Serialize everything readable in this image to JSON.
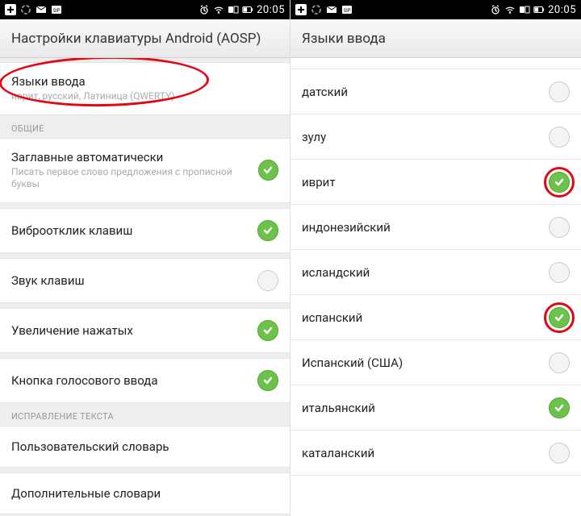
{
  "status": {
    "time": "20:05"
  },
  "left": {
    "title": "Настройки клавиатуры Android (AOSP)",
    "top_item": {
      "title": "Языки ввода",
      "subtitle": "иврит, русский, Латиница (QWERTY)"
    },
    "section_common": "ОБЩИЕ",
    "items": [
      {
        "title": "Заглавные автоматически",
        "subtitle": "Писать первое слово предложения с прописной буквы",
        "on": true
      },
      {
        "title": "Виброотклик клавиш",
        "on": true
      },
      {
        "title": "Звук клавиш",
        "on": false
      },
      {
        "title": "Увеличение нажатых",
        "on": true
      },
      {
        "title": "Кнопка голосового ввода",
        "on": true
      }
    ],
    "section_correction": "ИСПРАВЛЕНИЕ ТЕКСТА",
    "items2": [
      {
        "title": "Пользовательский словарь"
      },
      {
        "title": "Дополнительные словари"
      }
    ]
  },
  "right": {
    "title": "Языки ввода",
    "langs": [
      {
        "title": "датский",
        "on": false
      },
      {
        "title": "зулу",
        "on": false
      },
      {
        "title": "иврит",
        "on": true,
        "circled": true
      },
      {
        "title": "индонезийский",
        "on": false
      },
      {
        "title": "исландский",
        "on": false
      },
      {
        "title": "испанский",
        "on": true,
        "circled": true
      },
      {
        "title": "Испанский (США)",
        "on": false
      },
      {
        "title": "итальянский",
        "on": true
      },
      {
        "title": "каталанский",
        "on": false
      }
    ]
  }
}
